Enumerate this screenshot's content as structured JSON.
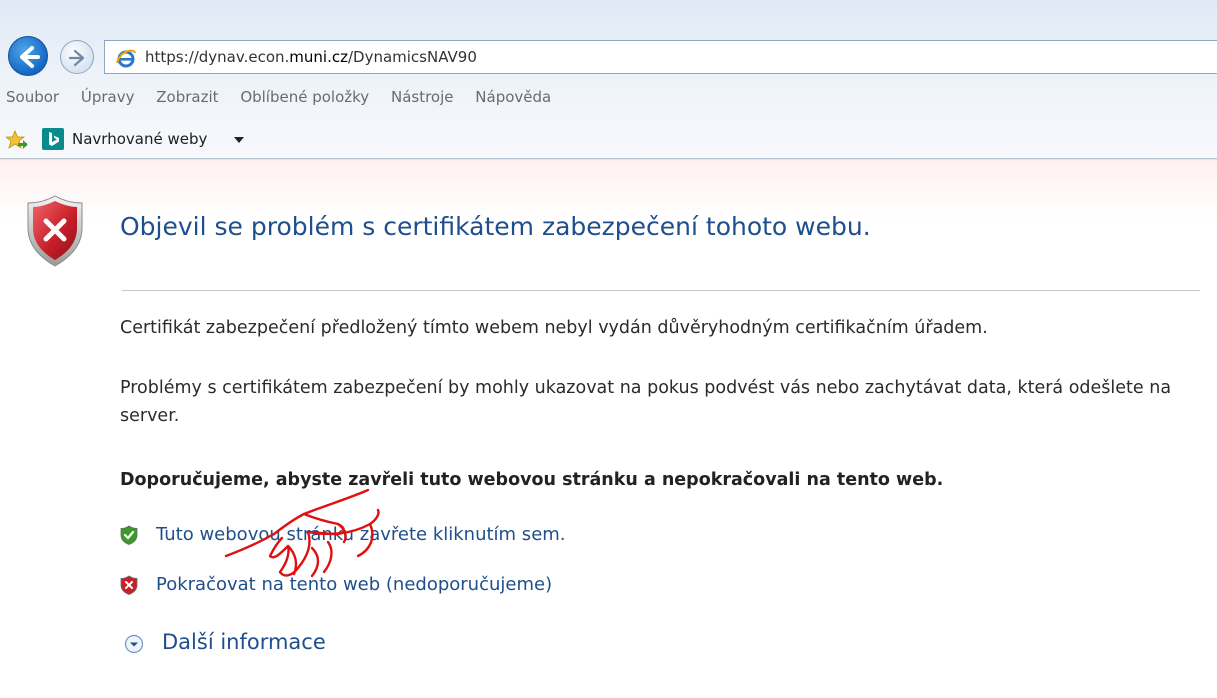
{
  "browser": {
    "url_prefix": "https://dynav.econ.",
    "url_domain": "muni.cz",
    "url_path": "/DynamicsNAV90",
    "menu": [
      "Soubor",
      "Úpravy",
      "Zobrazit",
      "Oblíbené položky",
      "Nástroje",
      "Nápověda"
    ],
    "favorites_label": "Navrhované weby"
  },
  "page": {
    "title": "Objevil se problém s certifikátem zabezpečení tohoto webu.",
    "paragraph_1": "Certifikát zabezpečení předložený tímto webem nebyl vydán důvěryhodným certifikačním úřadem.",
    "paragraph_2": "Problémy s certifikátem zabezpečení by mohly ukazovat na pokus podvést vás nebo zachytávat data, která odešlete na server.",
    "recommendation": "Doporučujeme, abyste zavřeli tuto webovou stránku a nepokračovali na tento web.",
    "close_link": "Tuto webovou stránku zavřete kliknutím sem.",
    "continue_link": "Pokračovat na tento web (nedoporučujeme)",
    "more_info": "Další informace"
  },
  "icons": {
    "error_shield": "error-shield-icon",
    "green_shield": "green-shield-icon",
    "red_shield": "red-shield-icon",
    "expand": "expand-chevron-icon"
  },
  "colors": {
    "link": "#1f4e8c",
    "title": "#1f4e8c",
    "error_red": "#c8202a",
    "safe_green": "#3a9a2a",
    "annotation_red": "#e01010"
  }
}
